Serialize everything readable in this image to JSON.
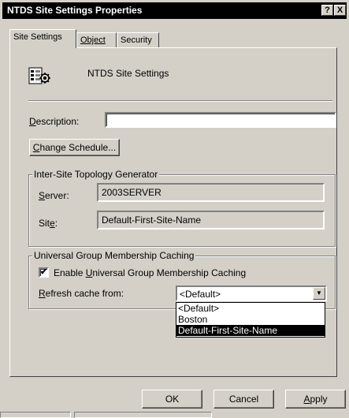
{
  "window": {
    "title": "NTDS Site Settings Properties",
    "help_label": "?",
    "close_label": "X"
  },
  "tabs": [
    {
      "label": "Site Settings",
      "active": true
    },
    {
      "label": "Object",
      "active": false
    },
    {
      "label": "Security",
      "active": false
    }
  ],
  "header": {
    "icon": "site-settings-icon",
    "title": "NTDS Site Settings"
  },
  "description": {
    "label_mnemonic": "D",
    "label_rest": "escription:",
    "value": ""
  },
  "change_schedule": {
    "label_mnemonic": "C",
    "label_rest": "hange Schedule..."
  },
  "istg_group": {
    "title": "Inter-Site Topology Generator",
    "server_label_mnemonic": "S",
    "server_label_rest": "erver:",
    "server_value": "2003SERVER",
    "site_label_pre": "Sit",
    "site_label_mnemonic": "e",
    "site_label_post": ":",
    "site_value": "Default-First-Site-Name"
  },
  "ugmc_group": {
    "title": "Universal Group Membership Caching",
    "enable_checked": true,
    "check_mark": "✔",
    "enable_pre": "Enable ",
    "enable_mnemonic": "U",
    "enable_post": "niversal Group Membership Caching",
    "refresh_mnemonic": "R",
    "refresh_rest": "efresh cache from:",
    "refresh_value": "<Default>",
    "arrow": "▼",
    "options": [
      "<Default>",
      "Boston",
      "Default-First-Site-Name"
    ],
    "highlighted_option": "Default-First-Site-Name"
  },
  "footer": {
    "ok_label": "OK",
    "cancel_label": "Cancel",
    "apply_mnemonic": "A",
    "apply_rest": "pply"
  }
}
